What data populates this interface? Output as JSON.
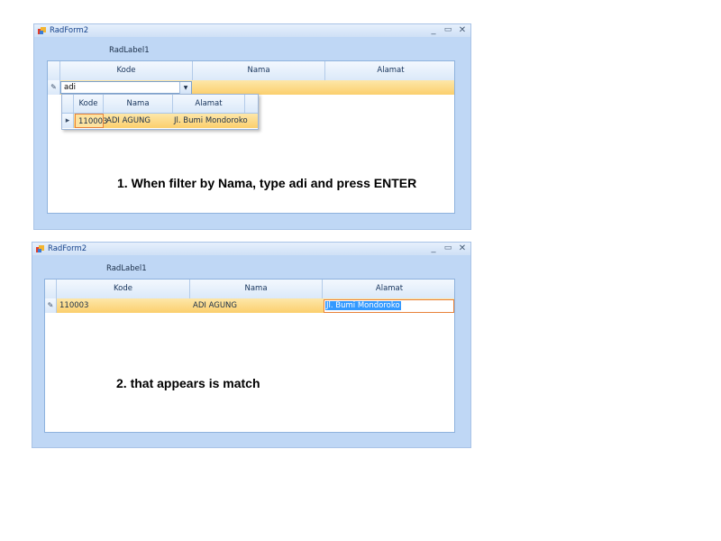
{
  "form1": {
    "title": "RadForm2",
    "label": "RadLabel1",
    "controls": {
      "minimize": "_",
      "maximize": "▭",
      "close": "✕"
    },
    "grid": {
      "columns": [
        "Kode",
        "Nama",
        "Alamat"
      ],
      "filter_text": "adi",
      "editor_icon": "✎",
      "dropdown_arrow": "▼",
      "popup": {
        "columns": [
          "Kode",
          "Nama",
          "Alamat"
        ],
        "row_indicator": "▸",
        "row": {
          "kode": "110003",
          "nama": "ADI AGUNG",
          "alamat": "Jl. Bumi Mondoroko"
        }
      }
    },
    "caption": "1. When filter by Nama, type adi and press ENTER"
  },
  "form2": {
    "title": "RadForm2",
    "label": "RadLabel1",
    "controls": {
      "minimize": "_",
      "maximize": "▭",
      "close": "✕"
    },
    "grid": {
      "columns": [
        "Kode",
        "Nama",
        "Alamat"
      ],
      "editor_icon": "✎",
      "row": {
        "kode": "110003",
        "nama": "ADI AGUNG",
        "alamat": "Jl. Bumi Mondoroko"
      }
    },
    "caption": "2. that appears is match"
  },
  "colors": {
    "window_bg": "#bfd7f5",
    "row_highlight": "#fbcf6d",
    "selection": "#3399ff",
    "focus_border": "#e8823a"
  }
}
